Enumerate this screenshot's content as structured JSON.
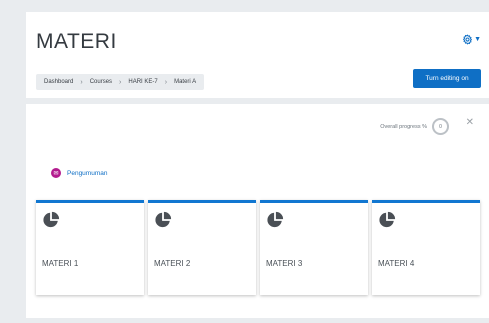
{
  "header": {
    "title": "MATERI",
    "settings_icon": "gear-icon",
    "breadcrumb": [
      "Dashboard",
      "Courses",
      "HARI KE-7",
      "Materi A"
    ],
    "edit_button": "Turn editing on",
    "accent_color": "#0f6fc5"
  },
  "course": {
    "progress_label": "Overall progress %",
    "progress_value": "0",
    "close_icon": "close-icon",
    "announcement": {
      "icon": "forum-icon",
      "label": "Pengumuman",
      "color": "#b31b8e"
    },
    "tiles": [
      {
        "label": "MATERI 1",
        "icon": "pie-chart-icon"
      },
      {
        "label": "MATERI 2",
        "icon": "pie-chart-icon"
      },
      {
        "label": "MATERI 3",
        "icon": "pie-chart-icon"
      },
      {
        "label": "MATERI 4",
        "icon": "pie-chart-icon"
      }
    ]
  }
}
